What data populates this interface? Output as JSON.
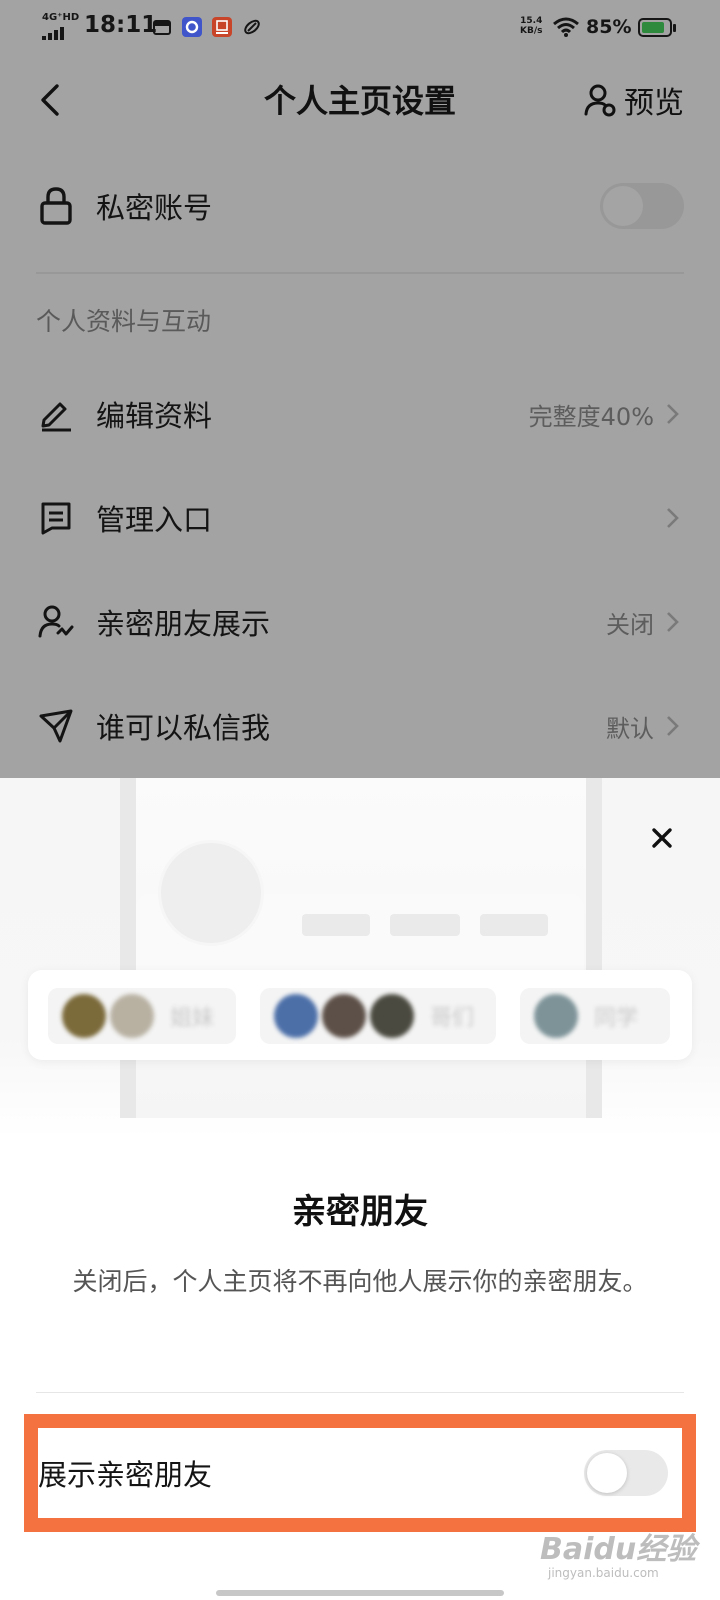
{
  "status_bar": {
    "network": "4G⁺HD",
    "time": "18:11",
    "speed_value": "15.4",
    "speed_unit": "KB/s",
    "battery_percent": "85%",
    "battery_level": 0.85,
    "icons": [
      "calendar-icon",
      "browser-icon",
      "news-app-icon",
      "link-icon",
      "wifi-icon",
      "battery-icon"
    ]
  },
  "header": {
    "title": "个人主页设置",
    "preview_label": "预览"
  },
  "settings": {
    "private_account": {
      "label": "私密账号",
      "enabled": false
    },
    "section_title": "个人资料与互动",
    "items": [
      {
        "icon": "edit-icon",
        "label": "编辑资料",
        "value": "完整度40%"
      },
      {
        "icon": "manage-icon",
        "label": "管理入口",
        "value": ""
      },
      {
        "icon": "close-friends-icon",
        "label": "亲密朋友展示",
        "value": "关闭"
      },
      {
        "icon": "send-icon",
        "label": "谁可以私信我",
        "value": "默认"
      }
    ]
  },
  "sheet": {
    "illustration_groups": [
      {
        "name": "姐妹",
        "colors": [
          "#7b6a3a",
          "#b8b1a2"
        ]
      },
      {
        "name": "哥们",
        "colors": [
          "#4c6fa8",
          "#5d5048",
          "#4b4a40"
        ]
      },
      {
        "name": "同学",
        "colors": [
          "#7d9398"
        ]
      }
    ],
    "title": "亲密朋友",
    "description": "关闭后，个人主页将不再向他人展示你的亲密朋友。",
    "toggle_label": "展示亲密朋友",
    "toggle_enabled": false,
    "highlight_color": "#f47240"
  },
  "watermark": {
    "main": "Baidu经验",
    "sub": "jingyan.baidu.com"
  }
}
